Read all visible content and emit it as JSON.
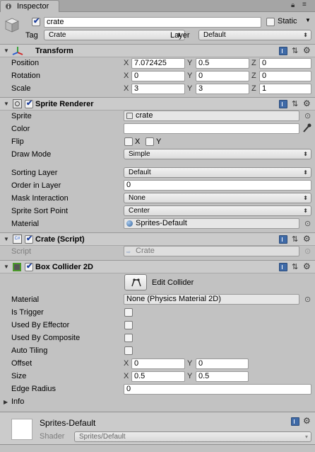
{
  "tab": {
    "label": "Inspector"
  },
  "gameobject": {
    "active": true,
    "name": "crate",
    "static_label": "Static",
    "static_checked": false,
    "tag_label": "Tag",
    "tag_value": "Crate",
    "layer_label": "Layer",
    "layer_value": "Default"
  },
  "transform": {
    "title": "Transform",
    "position": {
      "label": "Position",
      "x": "7.072425",
      "y": "0.5",
      "z": "0"
    },
    "rotation": {
      "label": "Rotation",
      "x": "0",
      "y": "0",
      "z": "0"
    },
    "scale": {
      "label": "Scale",
      "x": "3",
      "y": "3",
      "z": "1"
    },
    "axis_x": "X",
    "axis_y": "Y",
    "axis_z": "Z"
  },
  "sprite_renderer": {
    "title": "Sprite Renderer",
    "enabled": true,
    "sprite_label": "Sprite",
    "sprite_value": "crate",
    "color_label": "Color",
    "color_value": "#ffffff",
    "flip_label": "Flip",
    "flip_x": "X",
    "flip_y": "Y",
    "draw_mode_label": "Draw Mode",
    "draw_mode_value": "Simple",
    "sorting_layer_label": "Sorting Layer",
    "sorting_layer_value": "Default",
    "order_label": "Order in Layer",
    "order_value": "0",
    "mask_label": "Mask Interaction",
    "mask_value": "None",
    "sort_point_label": "Sprite Sort Point",
    "sort_point_value": "Center",
    "material_label": "Material",
    "material_value": "Sprites-Default"
  },
  "crate_script": {
    "title": "Crate (Script)",
    "enabled": true,
    "script_label": "Script",
    "script_value": "Crate"
  },
  "box_collider": {
    "title": "Box Collider 2D",
    "enabled": true,
    "edit_collider_label": "Edit Collider",
    "material_label": "Material",
    "material_value": "None (Physics Material 2D)",
    "is_trigger_label": "Is Trigger",
    "used_by_effector_label": "Used By Effector",
    "used_by_composite_label": "Used By Composite",
    "auto_tiling_label": "Auto Tiling",
    "offset_label": "Offset",
    "offset_x": "0",
    "offset_y": "0",
    "size_label": "Size",
    "size_x": "0.5",
    "size_y": "0.5",
    "edge_radius_label": "Edge Radius",
    "edge_radius_value": "0",
    "info_label": "Info",
    "axis_x": "X",
    "axis_y": "Y"
  },
  "material_preview": {
    "name": "Sprites-Default",
    "shader_label": "Shader",
    "shader_value": "Sprites/Default"
  }
}
